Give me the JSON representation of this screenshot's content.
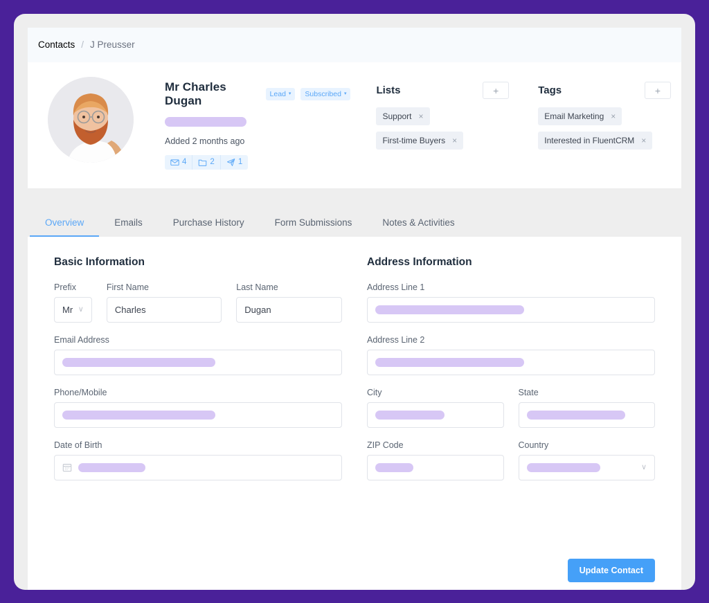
{
  "theme": {
    "page_bg": "#4a2199",
    "card_bg": "#eeeeee",
    "accent": "#45a0f8",
    "redaction": "#d7c7f5",
    "chip_bg": "#eef1f6",
    "badge_bg": "#e8f3ff"
  },
  "breadcrumb": {
    "root": "Contacts",
    "separator": "/",
    "current": "J Preusser"
  },
  "profile": {
    "avatar_alt": "contact-avatar-photo",
    "name": "Mr Charles Dugan",
    "badges": [
      {
        "label": "Lead",
        "caret": "▾"
      },
      {
        "label": "Subscribed",
        "caret": "▾"
      }
    ],
    "email_redacted": true,
    "added_text": "Added 2 months ago",
    "stats": [
      {
        "icon": "envelope-icon",
        "value": "4"
      },
      {
        "icon": "folder-icon",
        "value": "2"
      },
      {
        "icon": "paper-plane-icon",
        "value": "1"
      }
    ]
  },
  "lists_panel": {
    "title": "Lists",
    "add_label": "+",
    "items": [
      {
        "label": "Support",
        "remove": "×"
      },
      {
        "label": "First-time Buyers",
        "remove": "×"
      }
    ]
  },
  "tags_panel": {
    "title": "Tags",
    "add_label": "+",
    "items": [
      {
        "label": "Email Marketing",
        "remove": "×"
      },
      {
        "label": "Interested in FluentCRM",
        "remove": "×"
      }
    ]
  },
  "tabs": [
    {
      "label": "Overview",
      "active": true
    },
    {
      "label": "Emails",
      "active": false
    },
    {
      "label": "Purchase History",
      "active": false
    },
    {
      "label": "Form Submissions",
      "active": false
    },
    {
      "label": "Notes & Activities",
      "active": false
    }
  ],
  "basic_information": {
    "title": "Basic Information",
    "prefix": {
      "label": "Prefix",
      "value": "Mr",
      "chevron": "∨"
    },
    "first_name": {
      "label": "First Name",
      "value": "Charles"
    },
    "last_name": {
      "label": "Last Name",
      "value": "Dugan"
    },
    "email": {
      "label": "Email Address",
      "value": "",
      "redacted": true
    },
    "phone": {
      "label": "Phone/Mobile",
      "value": "",
      "redacted": true
    },
    "dob": {
      "label": "Date of Birth",
      "value": "",
      "redacted": true,
      "icon": "calendar-icon"
    }
  },
  "address_information": {
    "title": "Address Information",
    "address_line_1": {
      "label": "Address Line 1",
      "value": "",
      "redacted": true
    },
    "address_line_2": {
      "label": "Address Line 2",
      "value": "",
      "redacted": true
    },
    "city": {
      "label": "City",
      "value": "",
      "redacted": true
    },
    "state": {
      "label": "State",
      "value": "",
      "redacted": true
    },
    "zip": {
      "label": "ZIP Code",
      "value": "",
      "redacted": true
    },
    "country": {
      "label": "Country",
      "value": "",
      "redacted": true,
      "chevron": "∨"
    }
  },
  "actions": {
    "update_label": "Update Contact"
  }
}
